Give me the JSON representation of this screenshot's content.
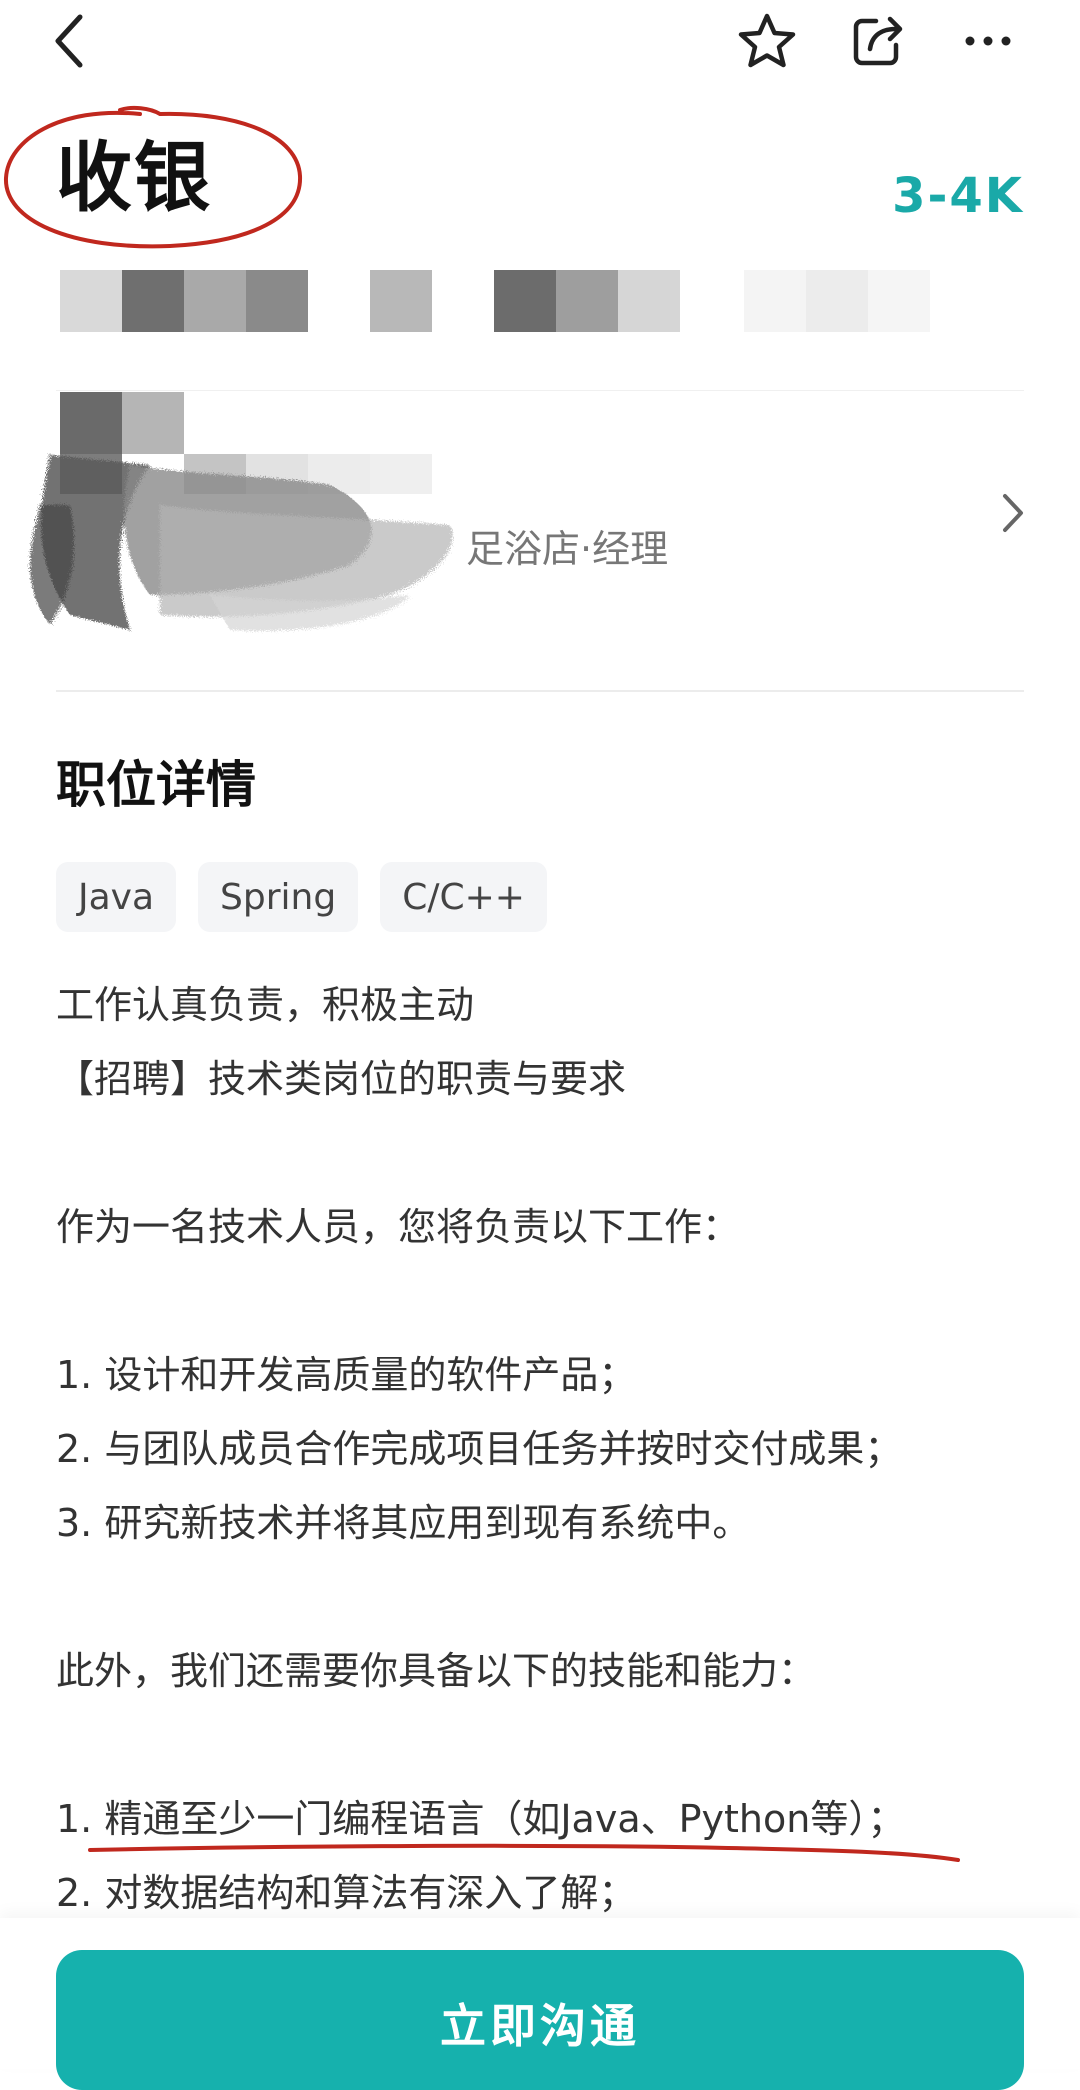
{
  "header": {
    "title": "收银",
    "salary": "3-4K"
  },
  "recruiter": {
    "role_visible": "足浴店·经理"
  },
  "detail": {
    "section_title": "职位详情",
    "skills": [
      "Java",
      "Spring",
      "C/C++"
    ],
    "lines": [
      "工作认真负责，积极主动",
      "【招聘】技术类岗位的职责与要求",
      "",
      "作为一名技术人员，您将负责以下工作：",
      "",
      "1. 设计和开发高质量的软件产品；",
      "2. 与团队成员合作完成项目任务并按时交付成果；",
      "3. 研究新技术并将其应用到现有系统中。",
      "",
      "此外，我们还需要你具备以下的技能和能力：",
      "",
      "1. 精通至少一门编程语言（如Java、Python等）；",
      "2. 对数据结构和算法有深入了解；"
    ]
  },
  "actions": {
    "chat_button": "立即沟通"
  },
  "colors": {
    "accent": "#16b1ad",
    "salary": "#1aa9a8",
    "annotation": "#c0281e"
  },
  "icons": {
    "back": "chevron-left-icon",
    "favorite": "star-icon",
    "share": "share-icon",
    "more": "more-icon",
    "go": "chevron-right-icon"
  }
}
